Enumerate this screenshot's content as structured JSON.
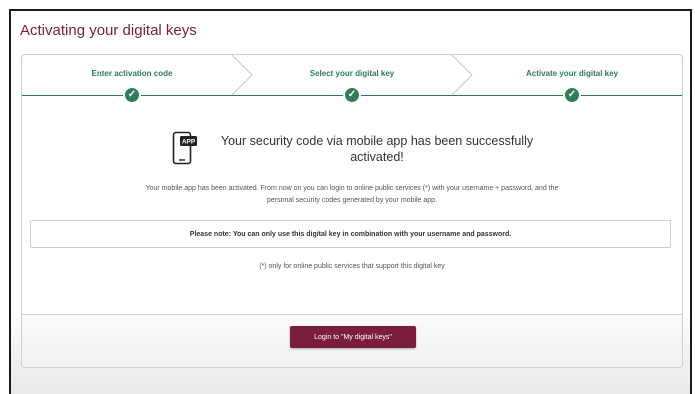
{
  "page": {
    "title": "Activating your digital keys"
  },
  "steps": [
    {
      "label": "Enter activation code",
      "status": "completed",
      "icon": "check-icon"
    },
    {
      "label": "Select your digital key",
      "status": "completed",
      "icon": "check-icon"
    },
    {
      "label": "Activate your digital key",
      "status": "completed",
      "icon": "check-icon"
    }
  ],
  "main": {
    "icon_badge": "APP",
    "heading": "Your security code via mobile app has been successfully activated!",
    "info": "Your mobile app has been activated. From now on you can login to online public services (*) with your username + password, and the personal security codes generated by your mobile app.",
    "note": "Please note: You can only use this digital key in combination with your username and password.",
    "footnote": "(*) only for online public services that support this digital key"
  },
  "actions": {
    "login_label": "Login to \"My digital keys\""
  },
  "colors": {
    "brand": "#7b1d3f",
    "step_green": "#2e7d57"
  }
}
